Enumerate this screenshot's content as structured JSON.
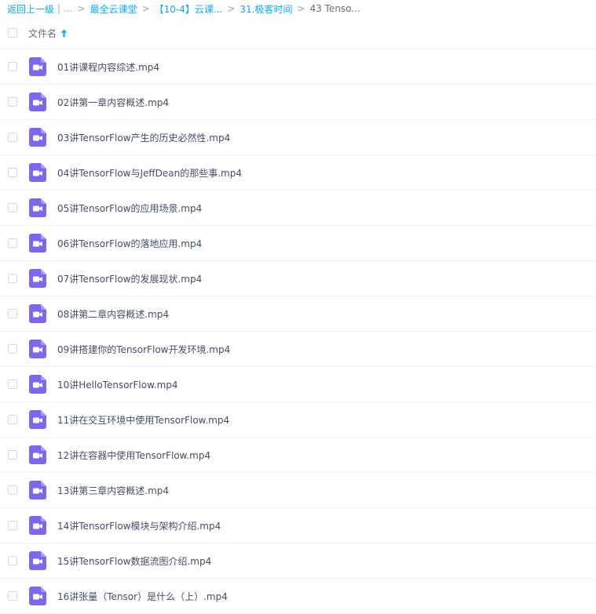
{
  "breadcrumb": {
    "back": "返回上一级",
    "sep1": "|",
    "ellipsis": "...",
    "crumbs": [
      "最全云课堂",
      "【10-4】云课...",
      "31.极客时间"
    ],
    "current": "43 Tenso..."
  },
  "header": {
    "column_label": "文件名",
    "sort": "ascending"
  },
  "colors": {
    "accent": "#09aaff",
    "video_icon": "#7b68ee"
  },
  "files": [
    "01讲课程内容综述.mp4",
    "02讲第一章内容概述.mp4",
    "03讲TensorFlow产生的历史必然性.mp4",
    "04讲TensorFlow与JeffDean的那些事.mp4",
    "05讲TensorFlow的应用场景.mp4",
    "06讲TensorFlow的落地应用.mp4",
    "07讲TensorFlow的发展现状.mp4",
    "08讲第二章内容概述.mp4",
    "09讲搭建你的TensorFlow开发环境.mp4",
    "10讲HelloTensorFlow.mp4",
    "11讲在交互环境中使用TensorFlow.mp4",
    "12讲在容器中使用TensorFlow.mp4",
    "13讲第三章内容概述.mp4",
    "14讲TensorFlow模块与架构介绍.mp4",
    "15讲TensorFlow数据流图介绍.mp4",
    "16讲张量（Tensor）是什么（上）.mp4"
  ]
}
